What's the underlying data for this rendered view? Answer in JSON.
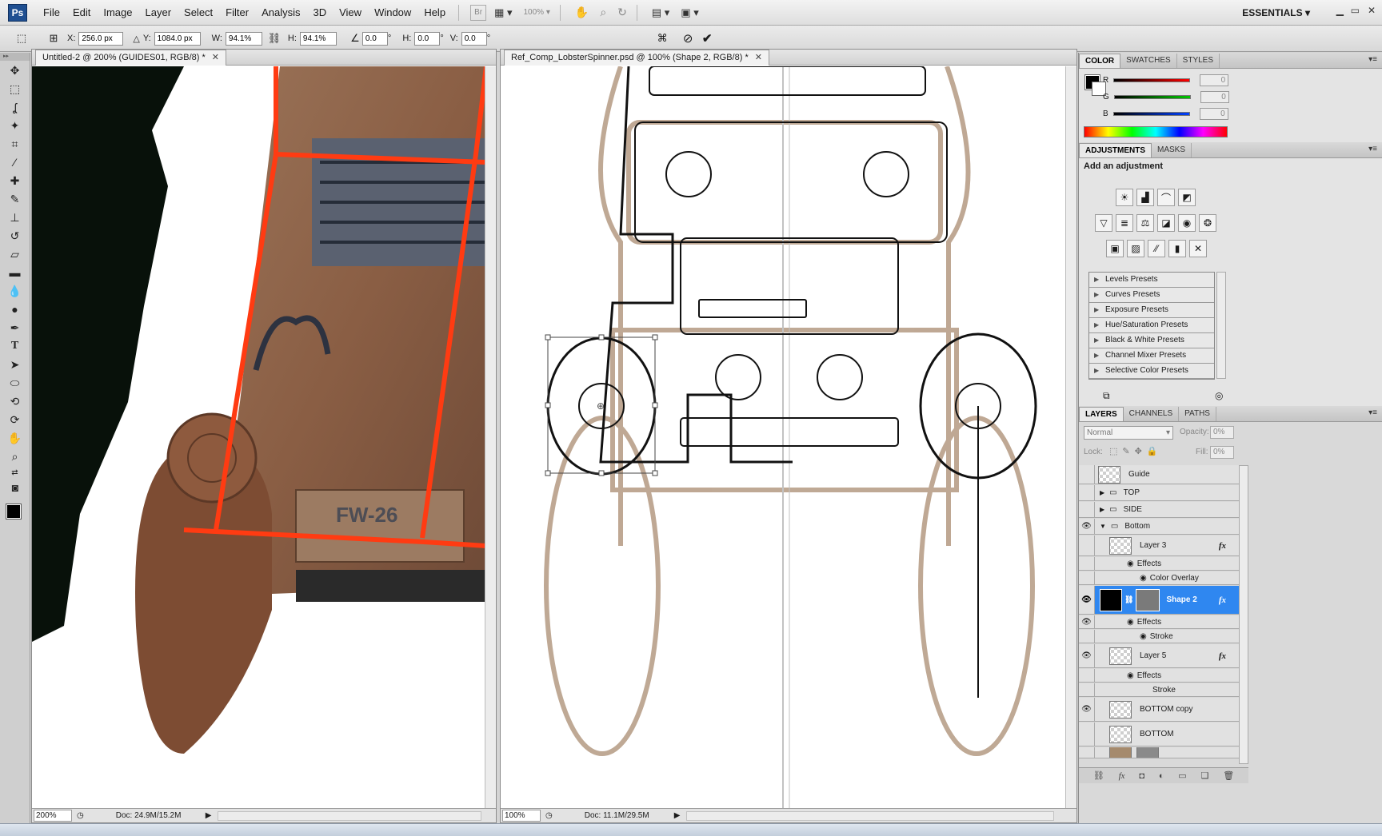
{
  "app": {
    "logo": "Ps",
    "menu": [
      "File",
      "Edit",
      "Image",
      "Layer",
      "Select",
      "Filter",
      "Analysis",
      "3D",
      "View",
      "Window",
      "Help"
    ],
    "bridge": "Br",
    "zoom_level": "100%",
    "workspace": "ESSENTIALS"
  },
  "options": {
    "x_label": "X:",
    "x_value": "256.0 px",
    "y_label": "Y:",
    "y_value": "1084.0 px",
    "w_label": "W:",
    "w_value": "94.1%",
    "h_label": "H:",
    "h_value": "94.1%",
    "angle_value": "0.0",
    "hskew_label": "H:",
    "hskew_value": "0.0",
    "vskew_label": "V:",
    "vskew_value": "0.0",
    "unit_deg": "°"
  },
  "doc1": {
    "tab_title": "Untitled-2 @ 200% (GUIDES01, RGB/8) *",
    "zoom": "200%",
    "doc_size": "Doc: 24.9M/15.2M",
    "plate_text": "FW-26"
  },
  "doc2": {
    "tab_title": "Ref_Comp_LobsterSpinner.psd @ 100% (Shape 2, RGB/8) *",
    "zoom": "100%",
    "doc_size": "Doc: 11.1M/29.5M"
  },
  "color_panel": {
    "tabs": [
      "COLOR",
      "SWATCHES",
      "STYLES"
    ],
    "r_label": "R",
    "r_value": "0",
    "g_label": "G",
    "g_value": "0",
    "b_label": "B",
    "b_value": "0"
  },
  "adjustments": {
    "tabs": [
      "ADJUSTMENTS",
      "MASKS"
    ],
    "heading": "Add an adjustment",
    "presets": [
      "Levels Presets",
      "Curves Presets",
      "Exposure Presets",
      "Hue/Saturation Presets",
      "Black & White Presets",
      "Channel Mixer Presets",
      "Selective Color Presets"
    ]
  },
  "layers_panel": {
    "tabs": [
      "LAYERS",
      "CHANNELS",
      "PATHS"
    ],
    "blend_mode": "Normal",
    "opacity_label": "Opacity:",
    "opacity_value": "0%",
    "lock_label": "Lock:",
    "fill_label": "Fill:",
    "fill_value": "0%",
    "layers": {
      "guide": "Guide",
      "top": "TOP",
      "side": "SIDE",
      "bottom": "Bottom",
      "layer3": "Layer 3",
      "layer3_effects": "Effects",
      "layer3_overlay": "Color Overlay",
      "shape2": "Shape 2",
      "shape2_effects": "Effects",
      "shape2_stroke": "Stroke",
      "layer5": "Layer 5",
      "layer5_effects": "Effects",
      "layer5_stroke": "Stroke",
      "bottom_copy": "BOTTOM copy",
      "bottom_layer": "BOTTOM"
    },
    "fx_label": "fx"
  }
}
